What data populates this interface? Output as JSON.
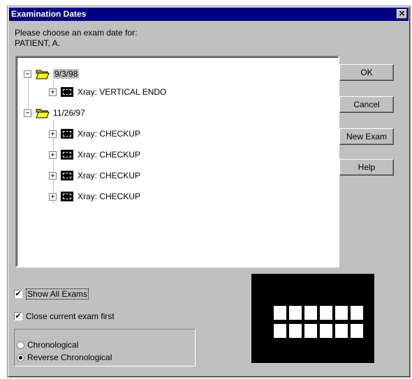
{
  "window": {
    "title": "Examination Dates",
    "close_glyph": "✕"
  },
  "prompt": {
    "line1": "Please choose an exam date for:",
    "line2": "PATIENT, A."
  },
  "tree": {
    "groups": [
      {
        "date": "9/3/98",
        "expanded": true,
        "items": [
          {
            "label": "Xray: VERTICAL ENDO",
            "icon": "xray-icon"
          }
        ]
      },
      {
        "date": "11/26/97",
        "expanded": true,
        "items": [
          {
            "label": "Xray: CHECKUP",
            "icon": "xray-icon"
          },
          {
            "label": "Xray: CHECKUP",
            "icon": "xray-icon"
          },
          {
            "label": "Xray: CHECKUP",
            "icon": "xray-icon"
          },
          {
            "label": "Xray: CHECKUP",
            "icon": "xray-icon"
          }
        ]
      }
    ],
    "collapse_glyph": "−",
    "expand_glyph": "+"
  },
  "buttons": {
    "ok": "OK",
    "cancel": "Cancel",
    "new_exam": "New Exam",
    "help": "Help"
  },
  "options": {
    "show_all_exams": {
      "label": "Show All Exams",
      "checked": true
    },
    "close_current_first": {
      "label": "Close current exam first",
      "checked": true
    },
    "check_glyph": "✔"
  },
  "sort": {
    "chronological": {
      "label": "Chronological",
      "selected": false
    },
    "reverse_chronological": {
      "label": "Reverse Chronological",
      "selected": true
    }
  },
  "colors": {
    "titlebar": "#000080",
    "dialog": "#c0c0c0",
    "preview_bg": "#000000"
  }
}
